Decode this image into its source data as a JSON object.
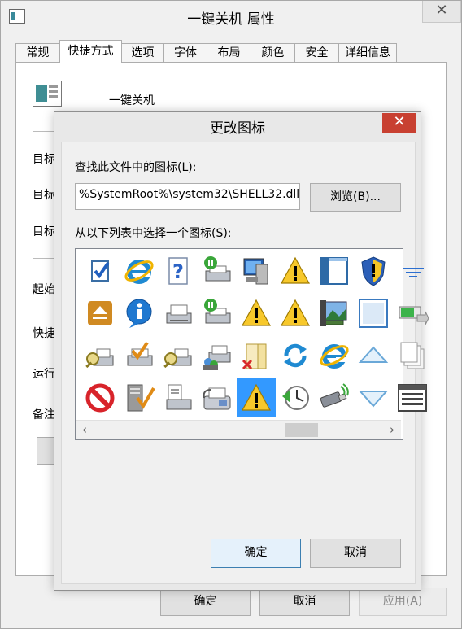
{
  "window": {
    "title": "一键关机 属性",
    "tabs": [
      "常规",
      "快捷方式",
      "选项",
      "字体",
      "布局",
      "颜色",
      "安全",
      "详细信息"
    ],
    "active_tab": "快捷方式",
    "shortcut_name": "一键关机",
    "field_labels": [
      "目标",
      "目标",
      "目标",
      "起始",
      "快捷",
      "运行",
      "备注"
    ],
    "buttons": {
      "ok": "确定",
      "cancel": "取消",
      "apply": "应用(A)"
    }
  },
  "dialog": {
    "title": "更改图标",
    "close_glyph": "✕",
    "file_label": "查找此文件中的图标(L):",
    "file_path": "%SystemRoot%\\system32\\SHELL32.dll",
    "browse_label": "浏览(B)...",
    "list_label": "从以下列表中选择一个图标(S):",
    "icons": [
      [
        "checkbox-icon",
        "internet-explorer-icon",
        "help-document-icon",
        "printer-paused-icon",
        "computer-icon",
        "warning-icon",
        "window-panel-icon",
        "security-shield-icon",
        "filter-lines-icon"
      ],
      [
        "eject-icon",
        "information-icon",
        "printer-icon",
        "printer-paused-icon",
        "warning-icon",
        "warning-icon",
        "photo-album-icon",
        "blank-window-icon",
        "battery-arrow-icon"
      ],
      [
        "printer-search-icon",
        "printer-check-icon",
        "printer-search-icon",
        "printer-shared-icon",
        "folder-delete-icon",
        "refresh-icon",
        "internet-explorer-icon",
        "triangle-up-icon",
        "stacked-pages-icon"
      ],
      [
        "blocked-icon",
        "server-check-icon",
        "printer-document-icon",
        "fax-icon",
        "warning-icon",
        "clock-back-icon",
        "usb-drive-icon",
        "triangle-down-icon",
        "window-list-icon"
      ]
    ],
    "selected_icon": {
      "row": 3,
      "col": 4
    },
    "buttons": {
      "ok": "确定",
      "cancel": "取消"
    }
  }
}
